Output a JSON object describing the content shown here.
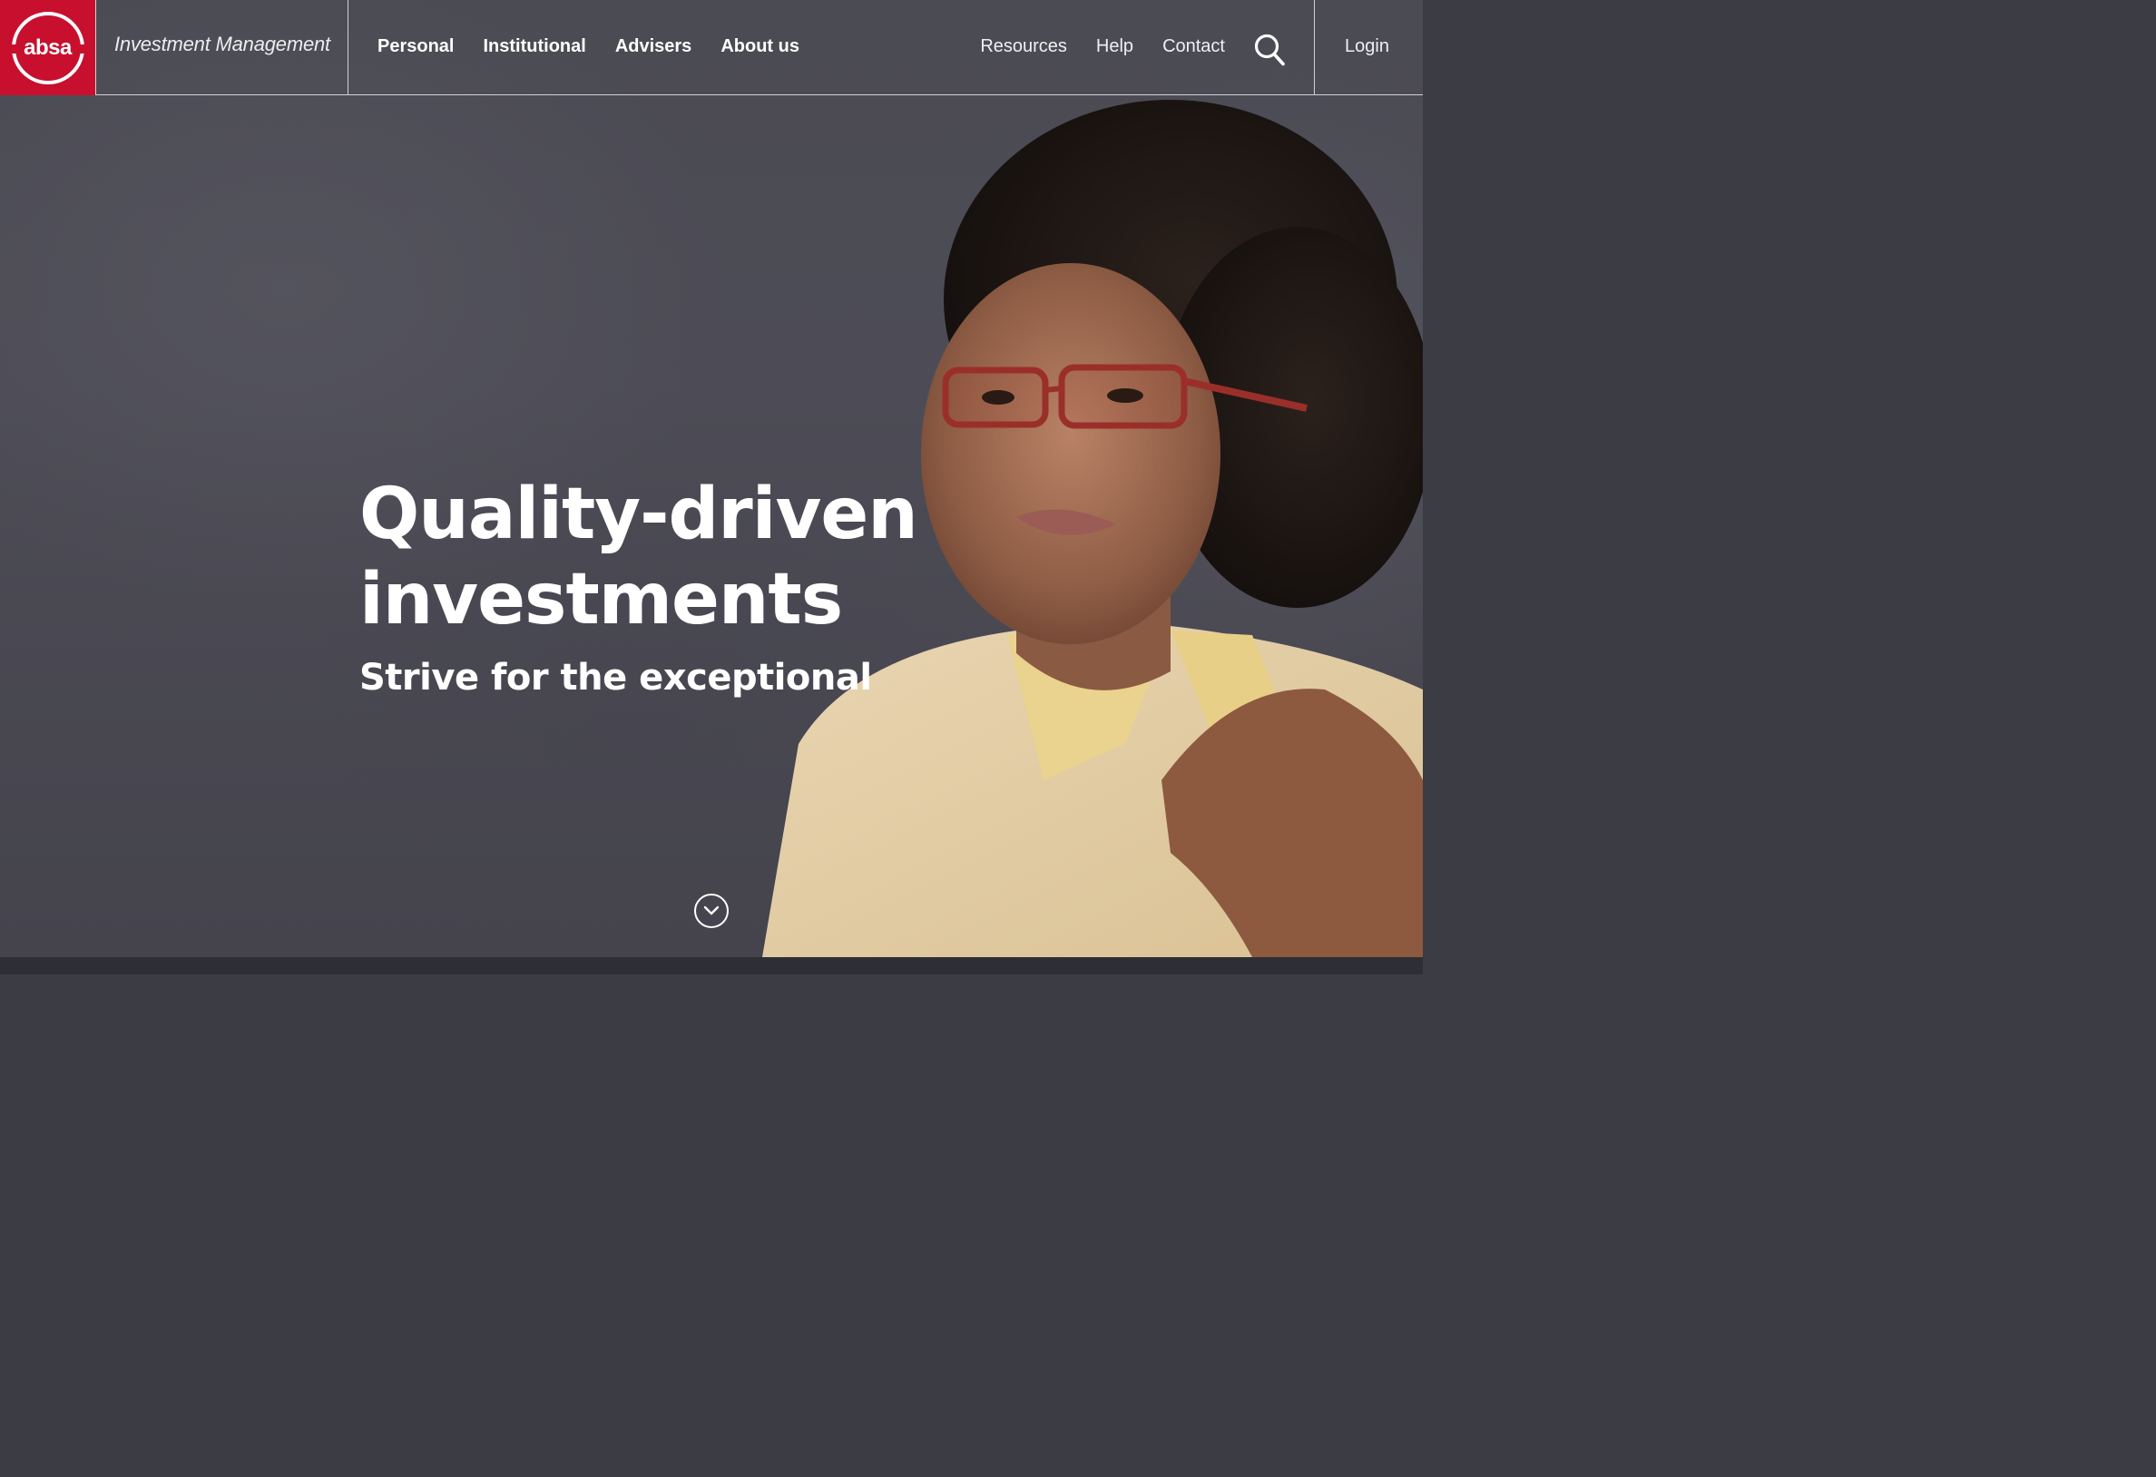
{
  "brand": {
    "logo_text": "absa",
    "subtitle": "Investment Management",
    "accent_color": "#c8102e"
  },
  "nav": {
    "main": [
      {
        "label": "Personal"
      },
      {
        "label": "Institutional"
      },
      {
        "label": "Advisers"
      },
      {
        "label": "About us"
      }
    ],
    "utility": [
      {
        "label": "Resources"
      },
      {
        "label": "Help"
      },
      {
        "label": "Contact"
      }
    ],
    "search_icon": "search-icon",
    "login_label": "Login"
  },
  "hero": {
    "headline_line1": "Quality-driven",
    "headline_line2": "investments",
    "subheadline": "Strive for the exceptional",
    "scroll_icon": "chevron-down-icon"
  }
}
